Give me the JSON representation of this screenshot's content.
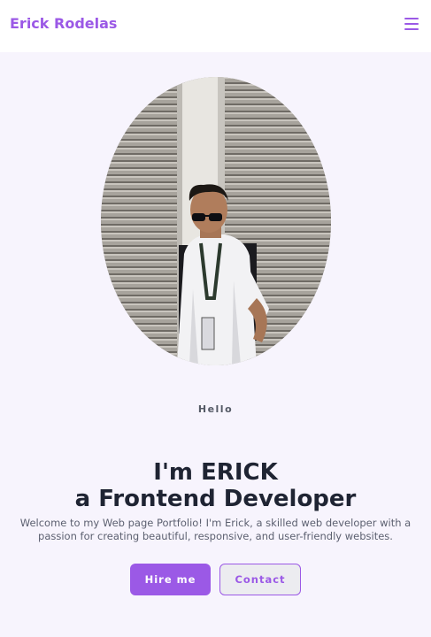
{
  "navbar": {
    "brand": "Erick Rodelas",
    "menu_icon": "hamburger-menu-icon",
    "accent_color": "#9b59e6"
  },
  "hero": {
    "photo": "profile-photo",
    "greeting": "Hello",
    "headline_prefix": "I'm ",
    "headline_name": "ERICK",
    "headline_article": "a",
    "headline_role": " Frontend Developer",
    "intro": "Welcome to my Web page Portfolio! I'm Erick, a skilled web developer with a passion for creating beautiful, responsive, and user-friendly websites.",
    "primary_button": "Hire me",
    "secondary_button": "Contact"
  }
}
